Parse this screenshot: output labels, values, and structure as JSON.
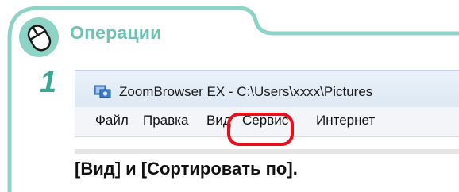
{
  "section": {
    "icon": "mouse-icon",
    "heading": "Операции",
    "step_number": "1"
  },
  "window": {
    "title": "ZoomBrowser EX  -  C:\\Users\\xxxx\\Pictures",
    "app_icon": "zoombrowser-app-icon",
    "menu": [
      {
        "label": "Файл"
      },
      {
        "label": "Правка"
      },
      {
        "label": "Вид"
      },
      {
        "label": "Сервис"
      },
      {
        "label": "Интернет"
      }
    ],
    "highlighted_menu": "Вид"
  },
  "instruction": "[Вид] и [Сортировать по].",
  "colors": {
    "accent": "#6fc2b3",
    "border": "#8fd3c6",
    "highlight": "#e8101c"
  }
}
